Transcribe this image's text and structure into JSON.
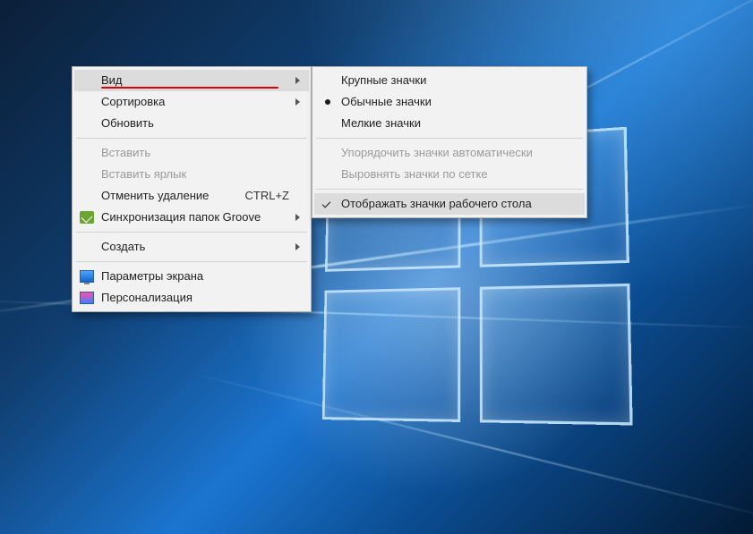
{
  "main_menu": {
    "view": {
      "label": "Вид"
    },
    "sort": {
      "label": "Сортировка"
    },
    "refresh": {
      "label": "Обновить"
    },
    "paste": {
      "label": "Вставить"
    },
    "paste_shortcut": {
      "label": "Вставить ярлык"
    },
    "undo_delete": {
      "label": "Отменить удаление",
      "shortcut": "CTRL+Z"
    },
    "groove_sync": {
      "label": "Синхронизация папок Groove"
    },
    "new": {
      "label": "Создать"
    },
    "display": {
      "label": "Параметры экрана"
    },
    "personalize": {
      "label": "Персонализация"
    }
  },
  "view_submenu": {
    "large_icons": {
      "label": "Крупные значки"
    },
    "medium_icons": {
      "label": "Обычные значки"
    },
    "small_icons": {
      "label": "Мелкие значки"
    },
    "auto_arrange": {
      "label": "Упорядочить значки автоматически"
    },
    "align_grid": {
      "label": "Выровнять значки по сетке"
    },
    "show_icons": {
      "label": "Отображать значки рабочего стола"
    }
  }
}
